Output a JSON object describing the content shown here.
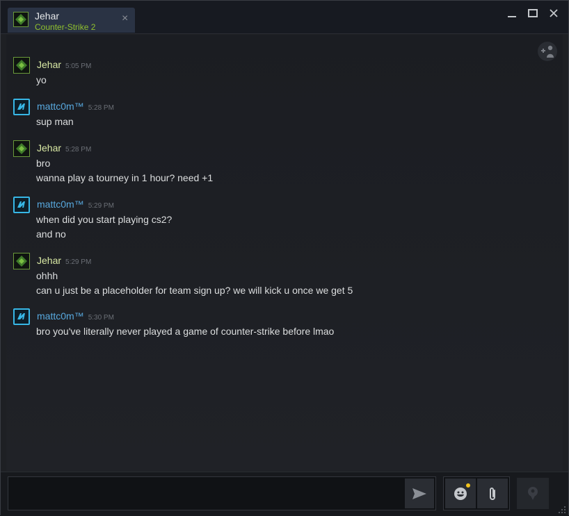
{
  "tab": {
    "name": "Jehar",
    "game": "Counter-Strike 2"
  },
  "messages": [
    {
      "sender": "Jehar",
      "time": "5:05 PM",
      "lines": [
        "yo"
      ]
    },
    {
      "sender": "mattc0m™",
      "time": "5:28 PM",
      "lines": [
        "sup man"
      ]
    },
    {
      "sender": "Jehar",
      "time": "5:28 PM",
      "lines": [
        "bro",
        "wanna play a tourney in 1 hour? need +1"
      ]
    },
    {
      "sender": "mattc0m™",
      "time": "5:29 PM",
      "lines": [
        "when did you start playing cs2?",
        "and no"
      ]
    },
    {
      "sender": "Jehar",
      "time": "5:29 PM",
      "lines": [
        "ohhh",
        "can u just be a placeholder for team sign up? we will kick u once we get 5"
      ]
    },
    {
      "sender": "mattc0m™",
      "time": "5:30 PM",
      "lines": [
        "bro you've literally never played a game of counter-strike before lmao"
      ]
    }
  ],
  "input": {
    "value": ""
  },
  "icons": {
    "close": "close-icon",
    "minimize": "minimize-icon",
    "maximize": "maximize-icon",
    "add_friend": "add-friend-icon",
    "send": "send-icon",
    "emoji": "emoji-icon",
    "attach": "paperclip-icon",
    "voice": "voice-icon"
  },
  "colors": {
    "jehar_name": "#d9e9a4",
    "matt_name": "#58a9df",
    "game_text": "#8fc12e",
    "notification_dot": "#f2c21b"
  }
}
